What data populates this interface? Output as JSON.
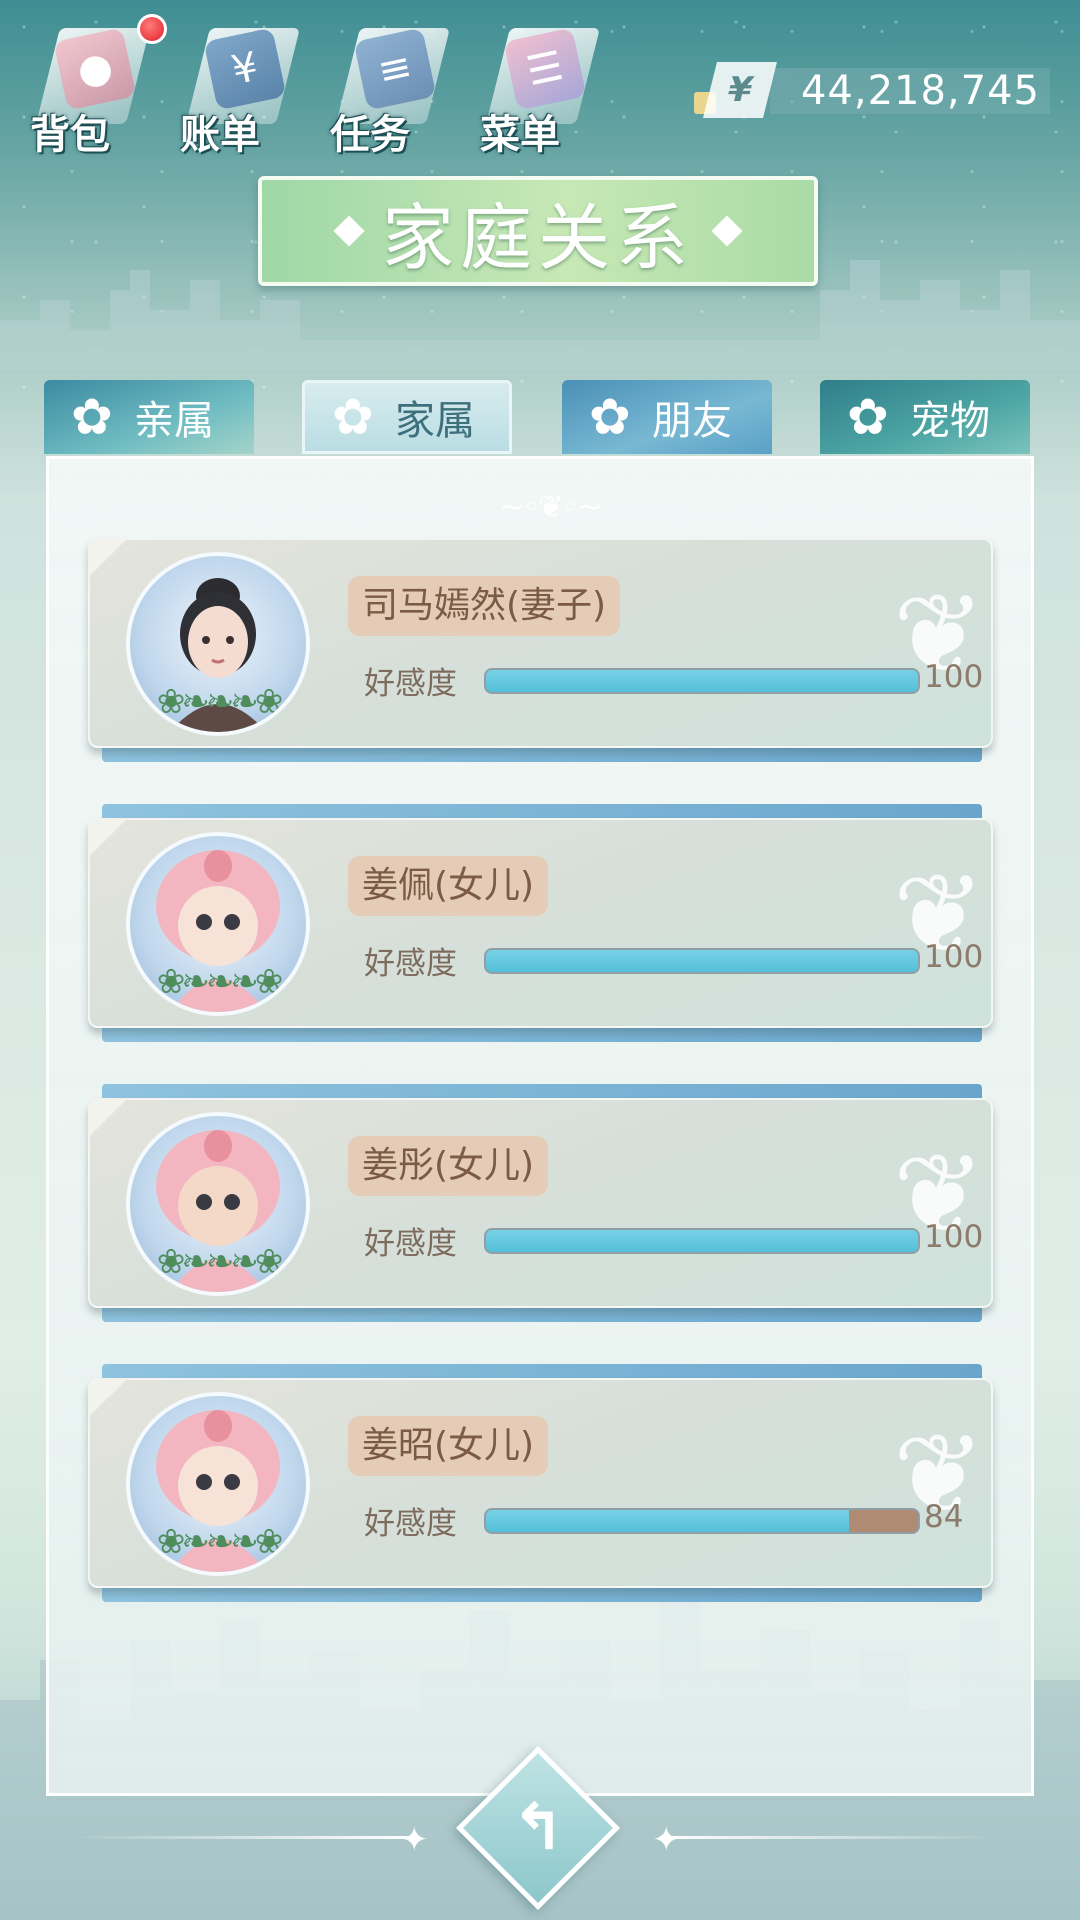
{
  "top_menu": {
    "items": [
      {
        "label": "背包",
        "icon": "bag-icon"
      },
      {
        "label": "账单",
        "icon": "bill-icon"
      },
      {
        "label": "任务",
        "icon": "task-icon"
      },
      {
        "label": "菜单",
        "icon": "menu-icon"
      }
    ],
    "notification_dot": true
  },
  "currency": {
    "symbol": "¥",
    "value": "44,218,745"
  },
  "title": "家庭关系",
  "tabs": [
    {
      "label": "亲属",
      "active": false
    },
    {
      "label": "家属",
      "active": true
    },
    {
      "label": "朋友",
      "active": false
    },
    {
      "label": "宠物",
      "active": false
    }
  ],
  "family": [
    {
      "name": "司马嫣然(妻子)",
      "affinity_label": "好感度",
      "affinity": 100,
      "affinity_max": 100,
      "avatar": "woman-avatar"
    },
    {
      "name": "姜佩(女儿)",
      "affinity_label": "好感度",
      "affinity": 100,
      "affinity_max": 100,
      "avatar": "child-pink-hood-avatar"
    },
    {
      "name": "姜彤(女儿)",
      "affinity_label": "好感度",
      "affinity": 100,
      "affinity_max": 100,
      "avatar": "child-pink-hood-avatar"
    },
    {
      "name": "姜昭(女儿)",
      "affinity_label": "好感度",
      "affinity": 84,
      "affinity_max": 100,
      "avatar": "child-pink-hood-avatar"
    }
  ],
  "colors": {
    "bar_fill": "#54bfd8",
    "bar_empty": "#b08b73",
    "title_green": "#a9dba5"
  }
}
